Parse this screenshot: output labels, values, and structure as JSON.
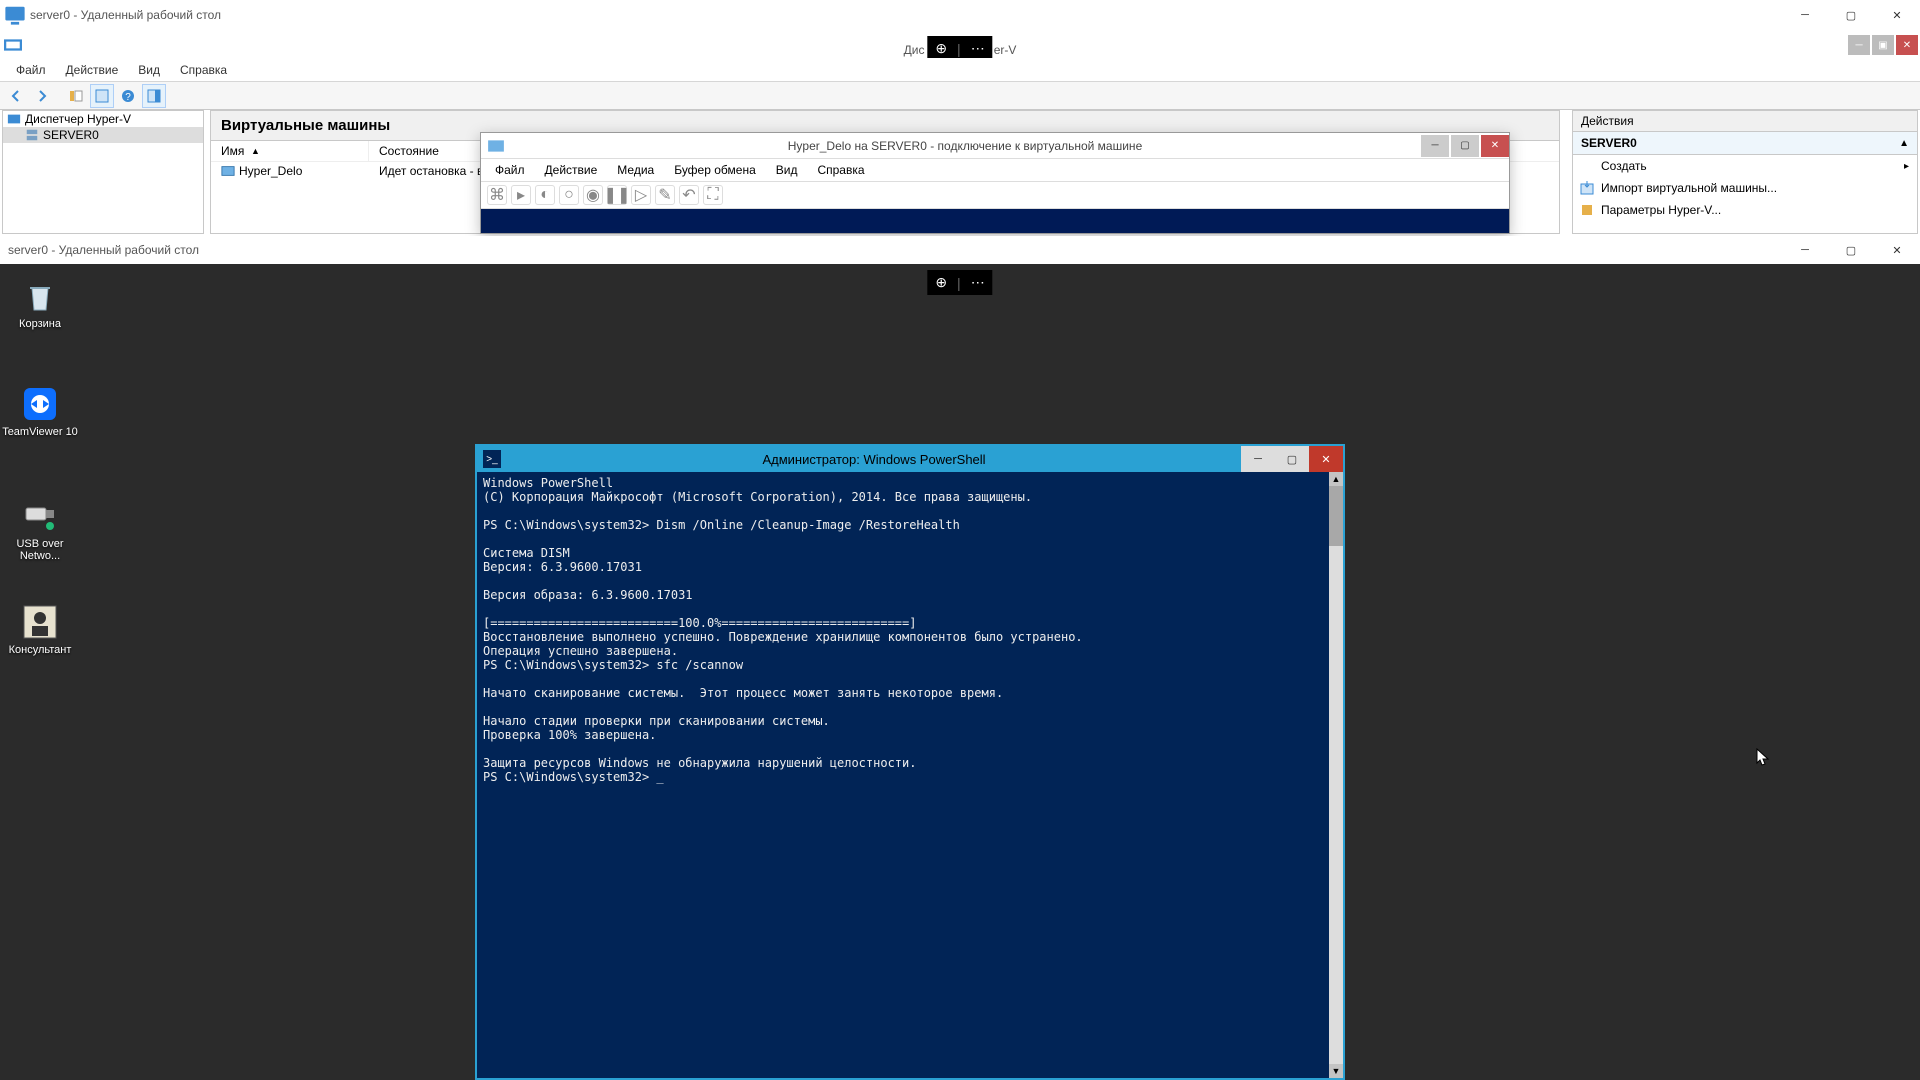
{
  "rdp1": {
    "title": "server0 - Удаленный рабочий стол",
    "hyperv_center_title": "Диспетчер Hyper-V",
    "hyperv_title_frag_left": "Дис",
    "hyperv_title_frag_right": "er-V",
    "menu": {
      "file": "Файл",
      "action": "Действие",
      "view": "Вид",
      "help": "Справка"
    },
    "tree": {
      "root": "Диспетчер Hyper-V",
      "server": "SERVER0"
    },
    "vm_list": {
      "header": "Виртуальные машины",
      "col_name": "Имя",
      "col_state": "Состояние",
      "row_name": "Hyper_Delo",
      "row_state": "Идет остановка - в"
    },
    "actions": {
      "title": "Действия",
      "server": "SERVER0",
      "create": "Создать",
      "import": "Импорт виртуальной машины...",
      "settings": "Параметры Hyper-V..."
    },
    "vmconn": {
      "title": "Hyper_Delo на SERVER0 - подключение к виртуальной машине",
      "menu": {
        "file": "Файл",
        "action": "Действие",
        "media": "Медиа",
        "clipboard": "Буфер обмена",
        "view": "Вид",
        "help": "Справка"
      }
    }
  },
  "rdp2": {
    "title": "server0 - Удаленный рабочий стол",
    "icons": {
      "recycle": "Корзина",
      "teamviewer": "TeamViewer 10",
      "usb": "USB over Netwo...",
      "consultant": "Консультант"
    }
  },
  "ps": {
    "title": "Администратор: Windows PowerShell",
    "body": "Windows PowerShell\n(C) Корпорация Майкрософт (Microsoft Corporation), 2014. Все права защищены.\n\nPS C:\\Windows\\system32> Dism /Online /Cleanup-Image /RestoreHealth\n\nCистема DISM\nВерсия: 6.3.9600.17031\n\nВерсия образа: 6.3.9600.17031\n\n[==========================100.0%==========================]\nВосстановление выполнено успешно. Повреждение хранилище компонентов было устранено.\nОперация успешно завершена.\nPS C:\\Windows\\system32> sfc /scannow\n\nНачато сканирование системы.  Этот процесс может занять некоторое время.\n\nНачало стадии проверки при сканировании системы.\nПроверка 100% завершена.\n\nЗащита ресурсов Windows не обнаружила нарушений целостности.\nPS C:\\Windows\\system32> _"
  }
}
